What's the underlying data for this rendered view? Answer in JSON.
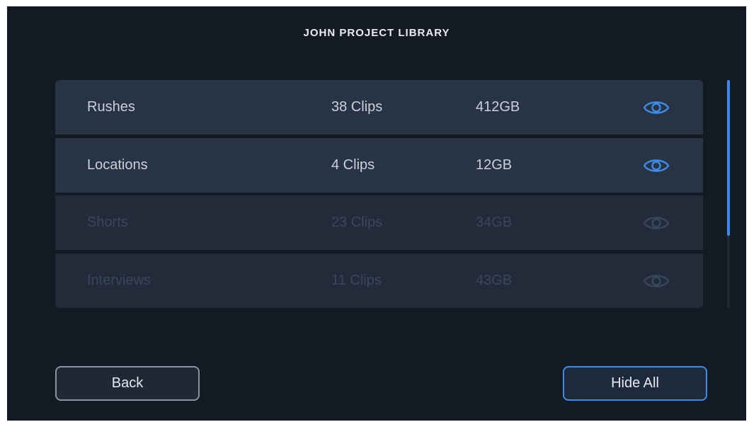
{
  "header": {
    "title": "JOHN PROJECT LIBRARY"
  },
  "rows": [
    {
      "name": "Rushes",
      "clips": "38 Clips",
      "size": "412GB",
      "visible": true
    },
    {
      "name": "Locations",
      "clips": "4 Clips",
      "size": "12GB",
      "visible": true
    },
    {
      "name": "Shorts",
      "clips": "23 Clips",
      "size": "34GB",
      "visible": false
    },
    {
      "name": "Interviews",
      "clips": "11 Clips",
      "size": "43GB",
      "visible": false
    }
  ],
  "icons": {
    "visibility": "eye-icon"
  },
  "colors": {
    "accent": "#3d8be8",
    "background": "#141a23",
    "row": "#283344",
    "eye_on": "#3d8be8",
    "eye_off": "#3a4659"
  },
  "footer": {
    "back_label": "Back",
    "hide_all_label": "Hide All"
  }
}
